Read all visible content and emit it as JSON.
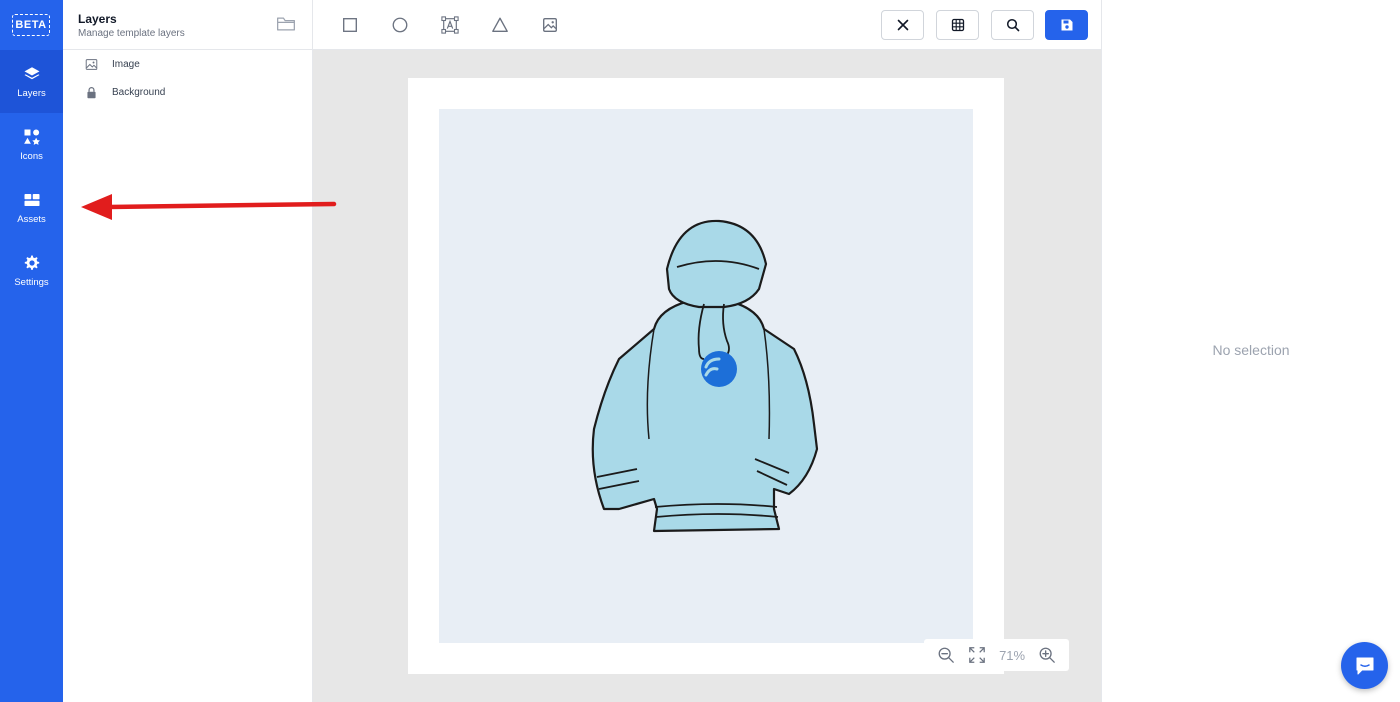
{
  "rail": {
    "badge": "BETA",
    "items": [
      {
        "label": "Layers",
        "icon": "layers-icon"
      },
      {
        "label": "Icons",
        "icon": "shapes-icon"
      },
      {
        "label": "Assets",
        "icon": "assets-icon"
      },
      {
        "label": "Settings",
        "icon": "gear-icon"
      }
    ]
  },
  "panel": {
    "title": "Layers",
    "subtitle": "Manage template layers",
    "layers": [
      {
        "label": "Image",
        "icon": "image-icon"
      },
      {
        "label": "Background",
        "icon": "lock-icon"
      }
    ]
  },
  "toolbar": {
    "tools": [
      "rectangle-icon",
      "circle-icon",
      "text-frame-icon",
      "triangle-icon",
      "image-icon"
    ],
    "buttons": [
      "close-icon",
      "grid-icon",
      "search-icon",
      "save-icon"
    ]
  },
  "zoom": {
    "value": "71%"
  },
  "properties": {
    "empty_text": "No selection"
  },
  "colors": {
    "accent": "#2563eb",
    "annotation": "#e11d1d",
    "hoodie": "#a9d9e8"
  }
}
